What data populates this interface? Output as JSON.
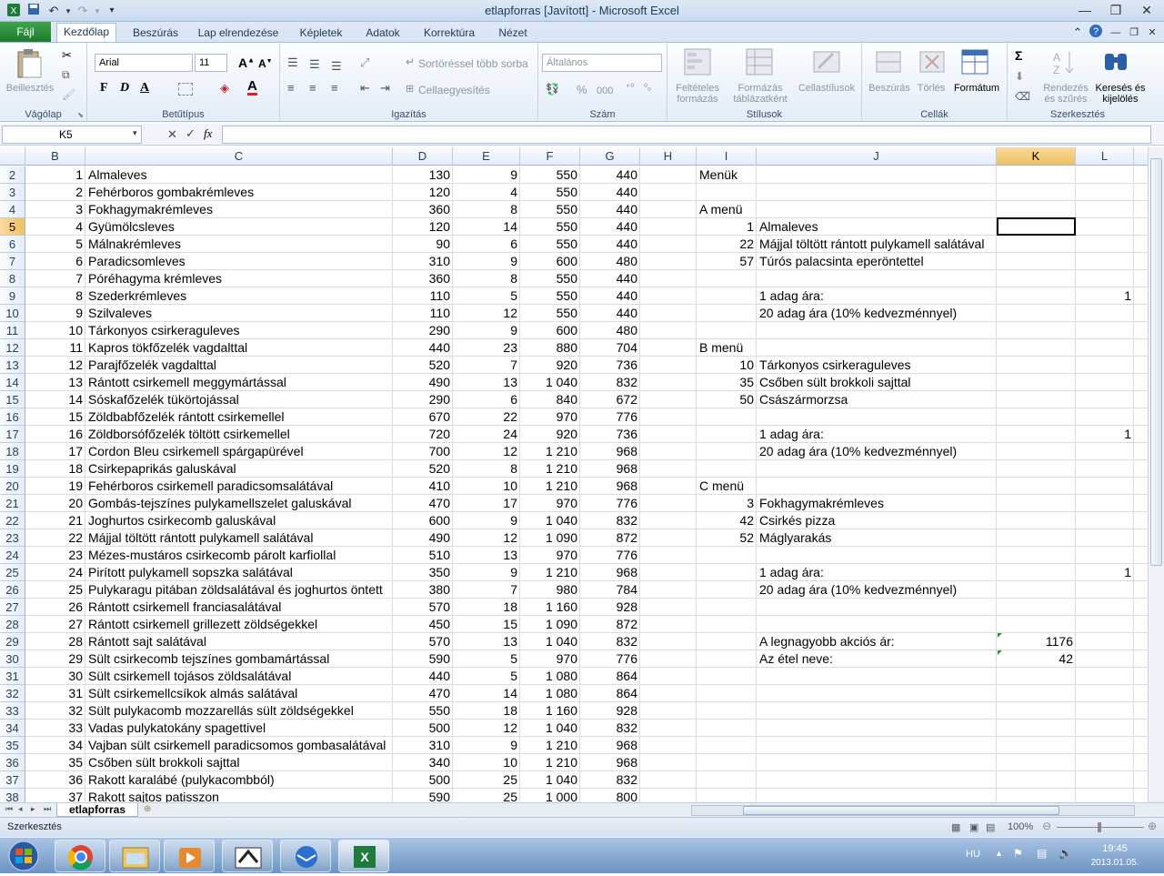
{
  "window": {
    "title": "etlapforras [Javított] - Microsoft Excel"
  },
  "tabs": {
    "file": "Fájl",
    "home": "Kezdőlap",
    "insert": "Beszúrás",
    "layout": "Lap elrendezése",
    "formulas": "Képletek",
    "data": "Adatok",
    "review": "Korrektúra",
    "view": "Nézet"
  },
  "ribbon": {
    "clipboard": {
      "label": "Vágólap",
      "paste": "Beillesztés"
    },
    "font": {
      "label": "Betűtípus",
      "name": "Arial",
      "size": "11",
      "bold": "F",
      "italic": "D",
      "underline": "A",
      "color": "A"
    },
    "align": {
      "label": "Igazítás",
      "wrap": "Sortöréssel több sorba",
      "merge": "Cellaegyesítés"
    },
    "number": {
      "label": "Szám",
      "format": "Általános",
      "percent": "%",
      "thousand": "000"
    },
    "styles": {
      "label": "Stílusok",
      "cond": "Feltételes formázás",
      "table": "Formázás táblázatként",
      "cell": "Cellastílusok"
    },
    "cells": {
      "label": "Cellák",
      "insert": "Beszúrás",
      "delete": "Törlés",
      "format": "Formátum"
    },
    "editing": {
      "label": "Szerkesztés",
      "sort": "Rendezés és szűrés",
      "find": "Keresés és kijelölés",
      "sum": "Σ"
    }
  },
  "formula_bar": {
    "name": "K5",
    "fx": "fx",
    "value": ""
  },
  "columns": [
    "B",
    "C",
    "D",
    "E",
    "F",
    "G",
    "H",
    "I",
    "J",
    "K",
    "L"
  ],
  "selected_column": "K",
  "selected_row": "5",
  "rows": [
    {
      "row": "2",
      "b": "1",
      "c": "Almaleves",
      "d": "130",
      "e": "9",
      "f": "550",
      "g": "440",
      "i": "Menük",
      "j": "",
      "k": "",
      "l": ""
    },
    {
      "row": "3",
      "b": "2",
      "c": "Fehérboros gombakrémleves",
      "d": "120",
      "e": "4",
      "f": "550",
      "g": "440",
      "i": "",
      "j": "",
      "k": "",
      "l": ""
    },
    {
      "row": "4",
      "b": "3",
      "c": "Fokhagymakrémleves",
      "d": "360",
      "e": "8",
      "f": "550",
      "g": "440",
      "i": "A menü",
      "j": "",
      "k": "",
      "l": ""
    },
    {
      "row": "5",
      "b": "4",
      "c": "Gyümölcsleves",
      "d": "120",
      "e": "14",
      "f": "550",
      "g": "440",
      "i": "1",
      "j": "Almaleves",
      "k": "",
      "l": ""
    },
    {
      "row": "6",
      "b": "5",
      "c": "Málnakrémleves",
      "d": "90",
      "e": "6",
      "f": "550",
      "g": "440",
      "i": "22",
      "j": "Májjal töltött rántott pulykamell salátával",
      "k": "",
      "l": ""
    },
    {
      "row": "7",
      "b": "6",
      "c": "Paradicsomleves",
      "d": "310",
      "e": "9",
      "f": "600",
      "g": "480",
      "i": "57",
      "j": "Túrós palacsinta eperöntettel",
      "k": "",
      "l": ""
    },
    {
      "row": "8",
      "b": "7",
      "c": "Póréhagyma krémleves",
      "d": "360",
      "e": "8",
      "f": "550",
      "g": "440",
      "i": "",
      "j": "",
      "k": "",
      "l": ""
    },
    {
      "row": "9",
      "b": "8",
      "c": "Szederkrémleves",
      "d": "110",
      "e": "5",
      "f": "550",
      "g": "440",
      "i": "",
      "j": "1 adag ára:",
      "k": "",
      "l": "1"
    },
    {
      "row": "10",
      "b": "9",
      "c": "Szilvaleves",
      "d": "110",
      "e": "12",
      "f": "550",
      "g": "440",
      "i": "",
      "j": "20 adag ára (10% kedvezménnyel)",
      "k": "",
      "l": ""
    },
    {
      "row": "11",
      "b": "10",
      "c": "Tárkonyos csirkeraguleves",
      "d": "290",
      "e": "9",
      "f": "600",
      "g": "480",
      "i": "",
      "j": "",
      "k": "",
      "l": ""
    },
    {
      "row": "12",
      "b": "11",
      "c": "Kapros tökfőzelék vagdalttal",
      "d": "440",
      "e": "23",
      "f": "880",
      "g": "704",
      "i": "B menü",
      "j": "",
      "k": "",
      "l": ""
    },
    {
      "row": "13",
      "b": "12",
      "c": "Parajfőzelék vagdalttal",
      "d": "520",
      "e": "7",
      "f": "920",
      "g": "736",
      "i": "10",
      "j": "Tárkonyos csirkeraguleves",
      "k": "",
      "l": ""
    },
    {
      "row": "14",
      "b": "13",
      "c": "Rántott csirkemell meggymártással",
      "d": "490",
      "e": "13",
      "f": "1 040",
      "g": "832",
      "i": "35",
      "j": "Csőben sült brokkoli sajttal",
      "k": "",
      "l": ""
    },
    {
      "row": "15",
      "b": "14",
      "c": "Sóskafőzelék tükörtojással",
      "d": "290",
      "e": "6",
      "f": "840",
      "g": "672",
      "i": "50",
      "j": "Császármorzsa",
      "k": "",
      "l": ""
    },
    {
      "row": "16",
      "b": "15",
      "c": "Zöldbabfőzelék rántott csirkemellel",
      "d": "670",
      "e": "22",
      "f": "970",
      "g": "776",
      "i": "",
      "j": "",
      "k": "",
      "l": ""
    },
    {
      "row": "17",
      "b": "16",
      "c": "Zöldborsófőzelék töltött csirkemellel",
      "d": "720",
      "e": "24",
      "f": "920",
      "g": "736",
      "i": "",
      "j": "1 adag ára:",
      "k": "",
      "l": "1"
    },
    {
      "row": "18",
      "b": "17",
      "c": "Cordon Bleu csirkemell spárgapürével",
      "d": "700",
      "e": "12",
      "f": "1 210",
      "g": "968",
      "i": "",
      "j": "20 adag ára (10% kedvezménnyel)",
      "k": "",
      "l": ""
    },
    {
      "row": "19",
      "b": "18",
      "c": "Csirkepaprikás galuskával",
      "d": "520",
      "e": "8",
      "f": "1 210",
      "g": "968",
      "i": "",
      "j": "",
      "k": "",
      "l": ""
    },
    {
      "row": "20",
      "b": "19",
      "c": "Fehérboros csirkemell paradicsomsalátával",
      "d": "410",
      "e": "10",
      "f": "1 210",
      "g": "968",
      "i": "C menü",
      "j": "",
      "k": "",
      "l": ""
    },
    {
      "row": "21",
      "b": "20",
      "c": "Gombás-tejszínes pulykamellszelet galuskával",
      "d": "470",
      "e": "17",
      "f": "970",
      "g": "776",
      "i": "3",
      "j": "Fokhagymakrémleves",
      "k": "",
      "l": ""
    },
    {
      "row": "22",
      "b": "21",
      "c": "Joghurtos csirkecomb galuskával",
      "d": "600",
      "e": "9",
      "f": "1 040",
      "g": "832",
      "i": "42",
      "j": "Csirkés pizza",
      "k": "",
      "l": ""
    },
    {
      "row": "23",
      "b": "22",
      "c": "Májjal töltött rántott pulykamell salátával",
      "d": "490",
      "e": "12",
      "f": "1 090",
      "g": "872",
      "i": "52",
      "j": "Máglyarakás",
      "k": "",
      "l": ""
    },
    {
      "row": "24",
      "b": "23",
      "c": "Mézes-mustáros csirkecomb párolt karfiollal",
      "d": "510",
      "e": "13",
      "f": "970",
      "g": "776",
      "i": "",
      "j": "",
      "k": "",
      "l": ""
    },
    {
      "row": "25",
      "b": "24",
      "c": "Pirított pulykamell sopszka salátával",
      "d": "350",
      "e": "9",
      "f": "1 210",
      "g": "968",
      "i": "",
      "j": "1 adag ára:",
      "k": "",
      "l": "1"
    },
    {
      "row": "26",
      "b": "25",
      "c": "Pulykaragu pitában zöldsalátával és joghurtos öntett",
      "d": "380",
      "e": "7",
      "f": "980",
      "g": "784",
      "i": "",
      "j": "20 adag ára (10% kedvezménnyel)",
      "k": "",
      "l": ""
    },
    {
      "row": "27",
      "b": "26",
      "c": "Rántott csirkemell franciasalátával",
      "d": "570",
      "e": "18",
      "f": "1 160",
      "g": "928",
      "i": "",
      "j": "",
      "k": "",
      "l": ""
    },
    {
      "row": "28",
      "b": "27",
      "c": "Rántott csirkemell grillezett zöldségekkel",
      "d": "450",
      "e": "15",
      "f": "1 090",
      "g": "872",
      "i": "",
      "j": "",
      "k": "",
      "l": ""
    },
    {
      "row": "29",
      "b": "28",
      "c": "Rántott sajt salátával",
      "d": "570",
      "e": "13",
      "f": "1 040",
      "g": "832",
      "i": "",
      "j": "A legnagyobb akciós ár:",
      "k": "1176",
      "l": ""
    },
    {
      "row": "30",
      "b": "29",
      "c": "Sült csirkecomb tejszínes gombamártással",
      "d": "590",
      "e": "5",
      "f": "970",
      "g": "776",
      "i": "",
      "j": "Az étel neve:",
      "k": "42",
      "l": ""
    },
    {
      "row": "31",
      "b": "30",
      "c": "Sült csirkemell tojásos zöldsalátával",
      "d": "440",
      "e": "5",
      "f": "1 080",
      "g": "864",
      "i": "",
      "j": "",
      "k": "",
      "l": ""
    },
    {
      "row": "32",
      "b": "31",
      "c": "Sült csirkemellcsíkok almás salátával",
      "d": "470",
      "e": "14",
      "f": "1 080",
      "g": "864",
      "i": "",
      "j": "",
      "k": "",
      "l": ""
    },
    {
      "row": "33",
      "b": "32",
      "c": "Sült pulykacomb mozzarellás sült zöldségekkel",
      "d": "550",
      "e": "18",
      "f": "1 160",
      "g": "928",
      "i": "",
      "j": "",
      "k": "",
      "l": ""
    },
    {
      "row": "34",
      "b": "33",
      "c": "Vadas pulykatokány spagettivel",
      "d": "500",
      "e": "12",
      "f": "1 040",
      "g": "832",
      "i": "",
      "j": "",
      "k": "",
      "l": ""
    },
    {
      "row": "35",
      "b": "34",
      "c": "Vajban sült csirkemell paradicsomos gombasalátával",
      "d": "310",
      "e": "9",
      "f": "1 210",
      "g": "968",
      "i": "",
      "j": "",
      "k": "",
      "l": ""
    },
    {
      "row": "36",
      "b": "35",
      "c": "Csőben sült brokkoli sajttal",
      "d": "340",
      "e": "10",
      "f": "1 210",
      "g": "968",
      "i": "",
      "j": "",
      "k": "",
      "l": ""
    },
    {
      "row": "37",
      "b": "36",
      "c": "Rakott karalábé (pulykacombból)",
      "d": "500",
      "e": "25",
      "f": "1 040",
      "g": "832",
      "i": "",
      "j": "",
      "k": "",
      "l": ""
    },
    {
      "row": "38",
      "b": "37",
      "c": "Rakott sajtos patisszon",
      "d": "590",
      "e": "25",
      "f": "1 000",
      "g": "800",
      "i": "",
      "j": "",
      "k": "",
      "l": ""
    }
  ],
  "sheet_tab": "etlapforras",
  "status": {
    "mode": "Szerkesztés",
    "zoom": "100%"
  },
  "taskbar": {
    "lang": "HU",
    "time": "19:45",
    "date": "2013.01.05."
  }
}
